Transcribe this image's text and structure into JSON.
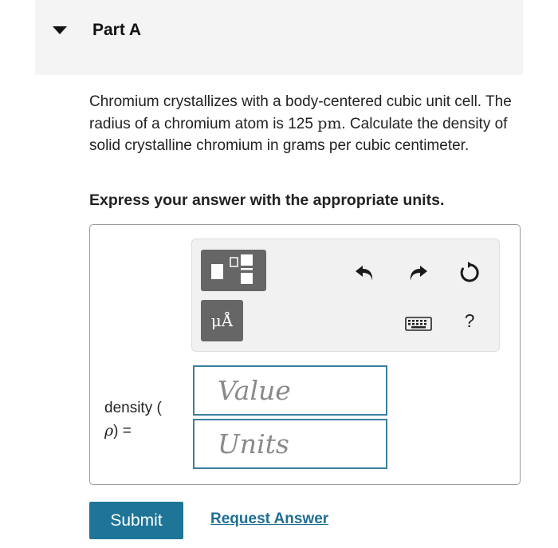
{
  "part": {
    "title": "Part A"
  },
  "question": {
    "text_before_unit": "Chromium crystallizes with a body-centered cubic unit cell. The radius of a chromium atom is 125 ",
    "unit": "pm",
    "text_after_unit": ". Calculate the density of solid crystalline chromium in grams per cubic centimeter.",
    "instruction": "Express your answer with the appropriate units."
  },
  "toolbar": {
    "template_icon": "fraction-template-icon",
    "units_label": "μÅ",
    "undo_icon": "undo-icon",
    "redo_icon": "redo-icon",
    "reset_icon": "reset-icon",
    "keyboard_icon": "keyboard-icon",
    "help_label": "?"
  },
  "answer": {
    "label_prefix": "density (",
    "label_symbol": "ρ",
    "label_suffix": ") =",
    "value_placeholder": "Value",
    "units_placeholder": "Units"
  },
  "actions": {
    "submit_label": "Submit",
    "request_answer_label": "Request Answer"
  },
  "colors": {
    "accent": "#1f7597",
    "link": "#1f6f93",
    "input_border": "#3a7fa0",
    "tool_button": "#666666"
  }
}
